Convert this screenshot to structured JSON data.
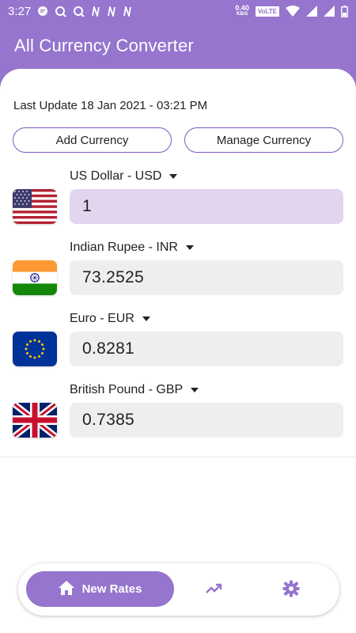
{
  "status_bar": {
    "time": "3:27",
    "net_speed": "0.40",
    "net_unit": "KB/S",
    "network_badge": "VoLTE"
  },
  "appbar": {
    "title": "All Currency Converter"
  },
  "last_update": "Last Update 18 Jan 2021 - 03:21 PM",
  "buttons": {
    "add_currency": "Add Currency",
    "manage_currency": "Manage Currency"
  },
  "currencies": [
    {
      "label": "US Dollar - USD",
      "value": "1",
      "flag": "us-flag-icon",
      "active": true
    },
    {
      "label": "Indian Rupee - INR",
      "value": "73.2525",
      "flag": "india-flag-icon",
      "active": false
    },
    {
      "label": "Euro - EUR",
      "value": "0.8281",
      "flag": "eu-flag-icon",
      "active": false
    },
    {
      "label": "British Pound - GBP",
      "value": "0.7385",
      "flag": "uk-flag-icon",
      "active": false
    }
  ],
  "bottom_nav": {
    "active_label": "New Rates",
    "items": [
      "home-icon",
      "trending-up-icon",
      "settings-icon"
    ]
  },
  "colors": {
    "primary": "#9575cd",
    "active_field": "#e1d6ee",
    "field": "#eeeeee"
  }
}
